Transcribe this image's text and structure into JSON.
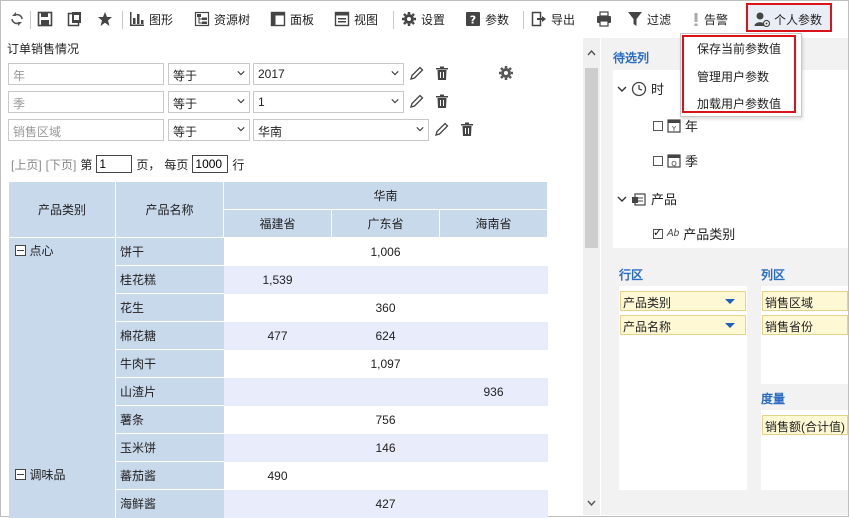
{
  "toolbar": {
    "items": {
      "graph": "图形",
      "resource_tree": "资源树",
      "panel": "面板",
      "view": "视图",
      "settings": "设置",
      "params": "参数",
      "export": "导出",
      "filter": "过滤",
      "alert": "告警",
      "personal_params": "个人参数"
    },
    "icons": [
      "refresh-icon",
      "save-icon",
      "save-as-icon",
      "star-icon",
      "bar-chart-icon",
      "tree-icon",
      "panel-icon",
      "view-icon",
      "gear-icon",
      "help-icon",
      "export-icon",
      "print-icon",
      "filter-icon",
      "alert-icon",
      "user-settings-icon"
    ]
  },
  "dropdown": {
    "items": [
      "保存当前参数值",
      "管理用户参数",
      "加载用户参数值"
    ]
  },
  "report": {
    "title": "订单销售情况",
    "params": [
      {
        "placeholder": "年",
        "operator": "等于",
        "value": "2017"
      },
      {
        "placeholder": "季",
        "operator": "等于",
        "value": "1"
      },
      {
        "placeholder": "销售区域",
        "operator": "等于",
        "value": "华南"
      }
    ],
    "pager": {
      "prev": "[上页]",
      "next": "[下页]",
      "page_label": "第",
      "page_value": "1",
      "page_suffix": "页，",
      "per_page_label": "每页",
      "per_page_value": "1000",
      "per_page_suffix": "行"
    }
  },
  "table": {
    "headers": {
      "category": "产品类别",
      "product": "产品名称",
      "region": "华南",
      "provinces": [
        "福建省",
        "广东省",
        "海南省"
      ]
    },
    "groups": [
      {
        "category": "点心",
        "rows": [
          {
            "name": "饼干",
            "vals": [
              "",
              "1,006",
              ""
            ]
          },
          {
            "name": "桂花糕",
            "vals": [
              "1,539",
              "",
              ""
            ]
          },
          {
            "name": "花生",
            "vals": [
              "",
              "360",
              ""
            ]
          },
          {
            "name": "棉花糖",
            "vals": [
              "477",
              "624",
              ""
            ]
          },
          {
            "name": "牛肉干",
            "vals": [
              "",
              "1,097",
              ""
            ]
          },
          {
            "name": "山渣片",
            "vals": [
              "",
              "",
              "936"
            ]
          },
          {
            "name": "薯条",
            "vals": [
              "",
              "756",
              ""
            ]
          },
          {
            "name": "玉米饼",
            "vals": [
              "",
              "146",
              ""
            ]
          }
        ]
      },
      {
        "category": "调味品",
        "rows": [
          {
            "name": "蕃茄酱",
            "vals": [
              "490",
              "",
              ""
            ]
          },
          {
            "name": "海鲜酱",
            "vals": [
              "",
              "427",
              ""
            ]
          }
        ]
      }
    ]
  },
  "side": {
    "candidates_title": "待选列",
    "tree": {
      "time": "时",
      "year": "年",
      "quarter": "季",
      "product": "产品",
      "product_category": "产品类别"
    },
    "row_area": "行区",
    "col_area": "列区",
    "measure": "度量",
    "row_fields": [
      "产品类别",
      "产品名称"
    ],
    "col_fields": [
      "销售区域",
      "销售省份"
    ],
    "measure_fields": [
      "销售额(合计值)"
    ]
  },
  "colors": {
    "accent": "#2a6cc4",
    "header_bg": "#c9d9ec",
    "highlight": "#d9121b"
  }
}
